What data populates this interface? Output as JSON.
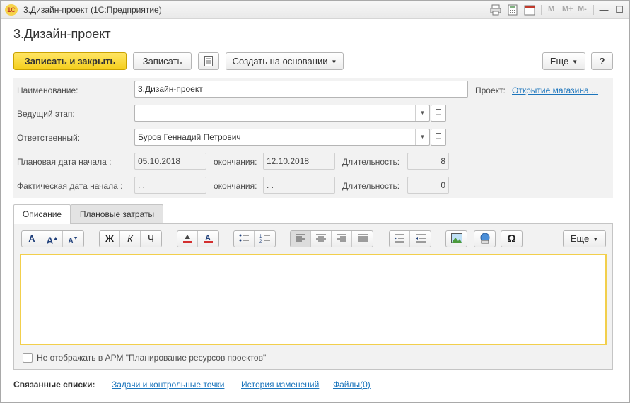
{
  "window": {
    "title": "3.Дизайн-проект  (1С:Предприятие)",
    "logo": "1С",
    "m_labels": [
      "M",
      "M+",
      "M-"
    ],
    "toolbar_icons": [
      "print-icon",
      "calc-icon",
      "calendar-icon"
    ],
    "calendar_glyph": "31",
    "controls": {
      "minimize": "—",
      "maximize": "☐",
      "close": "✕"
    }
  },
  "form": {
    "title": "3.Дизайн-проект"
  },
  "toolbar": {
    "save_close": "Записать и закрыть",
    "save": "Записать",
    "create_based": "Создать на основании",
    "more": "Еще",
    "help": "?"
  },
  "fields": {
    "name_label": "Наименование:",
    "name_value": "3.Дизайн-проект",
    "project_label": "Проект:",
    "project_link": "Открытие магазина ...",
    "lead_stage_label": "Ведущий этап:",
    "lead_stage_value": "",
    "responsible_label": "Ответственный:",
    "responsible_value": "Буров Геннадий Петрович",
    "planned_start_label": "Плановая дата начала :",
    "planned_start_value": "05.10.2018",
    "planned_end_label": "окончания:",
    "planned_end_value": "12.10.2018",
    "planned_duration_label": "Длительность:",
    "planned_duration_value": "8",
    "actual_start_label": "Фактическая дата начала :",
    "actual_start_value": " .  .",
    "actual_end_label": "окончания:",
    "actual_end_value": " .  .",
    "actual_duration_label": "Длительность:",
    "actual_duration_value": "0"
  },
  "tabs": [
    {
      "label": "Описание",
      "active": true
    },
    {
      "label": "Плановые затраты",
      "active": false
    }
  ],
  "editor": {
    "font_buttons": [
      "A",
      "A",
      "A"
    ],
    "style_buttons": [
      "Ж",
      "К",
      "Ч"
    ],
    "more": "Еще",
    "omega": "Ω",
    "content": ""
  },
  "checkbox": {
    "label": "Не отображать в АРМ \"Планирование ресурсов проектов\"",
    "checked": false
  },
  "related": {
    "label": "Связанные списки:",
    "links": [
      "Задачи и контрольные точки",
      "История изменений",
      "Файлы(0)"
    ]
  }
}
